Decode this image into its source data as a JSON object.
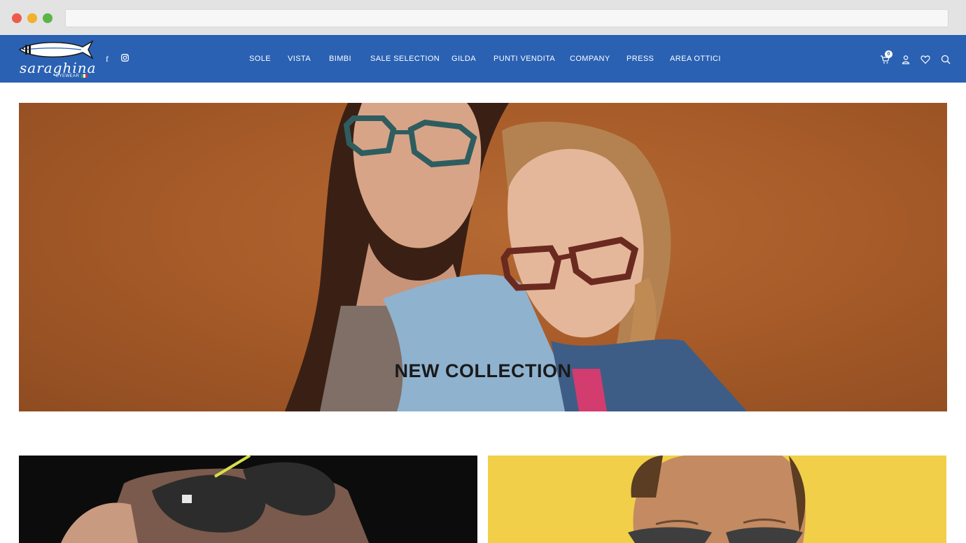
{
  "brand": {
    "name": "saraghina",
    "tagline": "EYEWEAR"
  },
  "social": [
    {
      "icon": "facebook-icon",
      "glyph": "f"
    },
    {
      "icon": "instagram-icon"
    }
  ],
  "nav": {
    "items": [
      {
        "label": "SOLE"
      },
      {
        "label": "VISTA"
      },
      {
        "label": "BIMBI"
      },
      {
        "label": "SALE SELECTION"
      },
      {
        "label": "GILDA"
      },
      {
        "label": "PUNTI VENDITA"
      },
      {
        "label": "COMPANY"
      },
      {
        "label": "PRESS"
      },
      {
        "label": "AREA OTTICI"
      }
    ]
  },
  "header_icons": {
    "cart_count": "0",
    "icons": [
      "cart-icon",
      "user-icon",
      "heart-icon",
      "search-icon"
    ]
  },
  "hero": {
    "title": "NEW COLLECTION"
  },
  "colors": {
    "header_bg": "#2a61b3",
    "hero_bg": "#a85c29",
    "tile_dark": "#0c0c0c",
    "tile_yellow": "#f1cf48"
  }
}
